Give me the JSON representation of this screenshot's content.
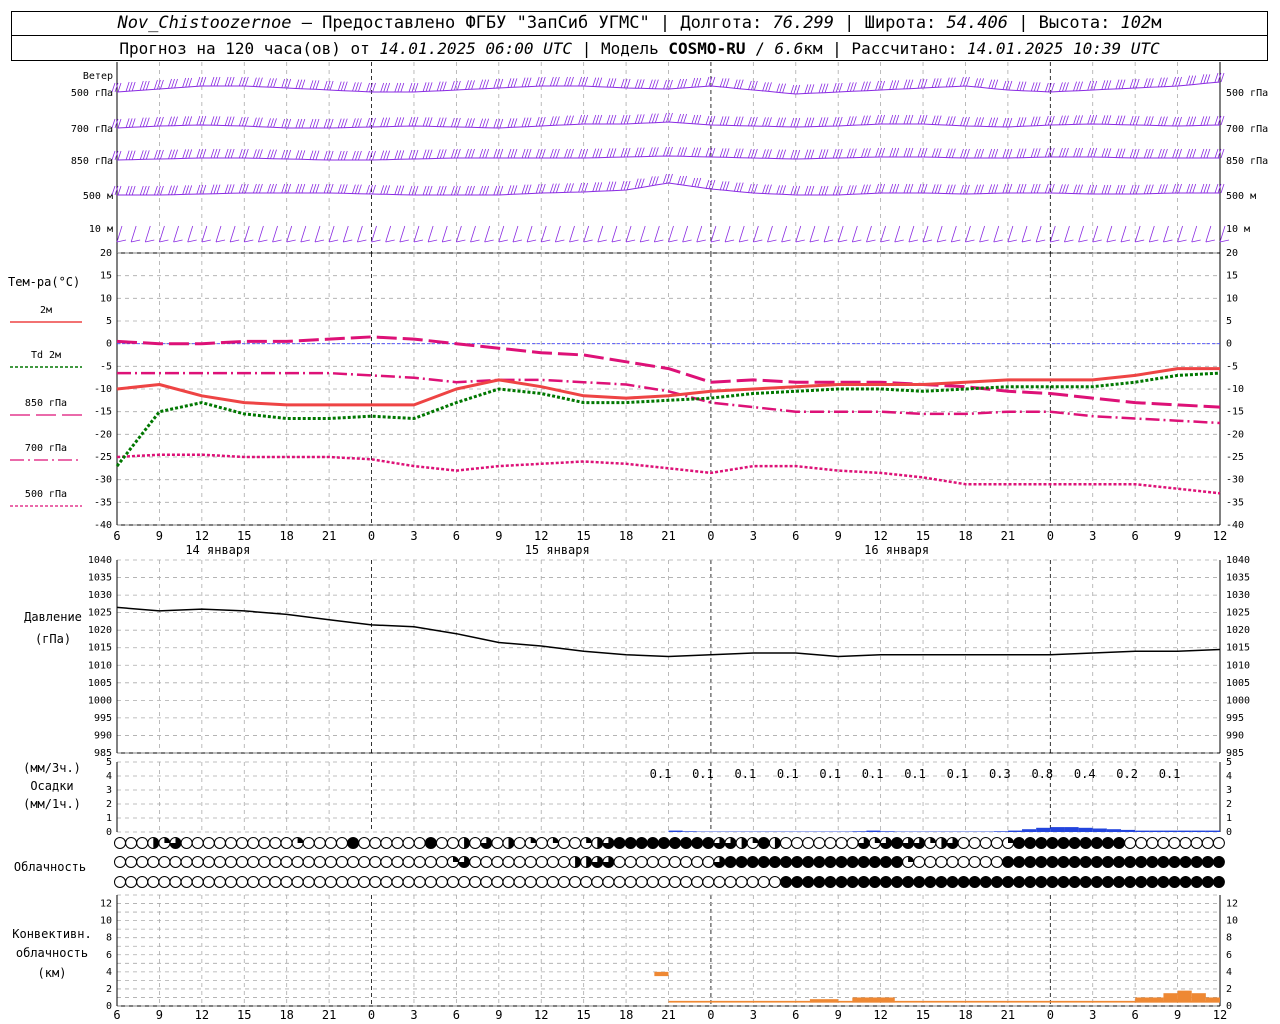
{
  "header": {
    "station": "Nov_Chistoozernoe",
    "provider": " — Предоставлено ФГБУ \"ЗапСиб УГМС\" | Долгота: ",
    "lon": "76.299",
    "lat_label": " | Широта: ",
    "lat": "54.406",
    "alt_label": " | Высота: ",
    "alt": "102",
    "alt_unit": "м",
    "forecast_pre": "Прогноз на 120 часа(ов) от ",
    "forecast_from": "14.01.2025 06:00 UTC",
    "model_label": "  | Модель ",
    "model": "COSMO-RU",
    "sep": " / ",
    "res": "6.6",
    "res_unit": "км | Рассчитано: ",
    "calc": "14.01.2025 10:39 UTC"
  },
  "labels": {
    "wind_title": "Ветер",
    "wind_levels": [
      "500 гПа",
      "700 гПа",
      "850 гПа",
      "500 м",
      "10  м"
    ],
    "temp_title": "Тем-ра(°С)",
    "legend": [
      "2м",
      "Td  2м",
      "850 гПа",
      "700 гПа",
      "500 гПа"
    ],
    "pressure_title": "Давление",
    "pressure_unit": "(гПа)",
    "precip": [
      "(мм/3ч.)",
      "Осадки",
      "(мм/1ч.)"
    ],
    "cloud_title": "Облачность",
    "conv": [
      "Конвективн.",
      "облачность",
      "(км)"
    ]
  },
  "colors": {
    "wind": "#8a2be2",
    "t2m": "#ee4444",
    "td2m": "#007700",
    "t850": "#dd1177",
    "t700": "#dd1177",
    "t500": "#dd1177",
    "pressure": "#000000",
    "precip": "#2244dd",
    "conv": "#ee8833",
    "zero": "#4444ff"
  },
  "chart_data": [
    {
      "type": "line",
      "title": "Тем-ра(°С)",
      "ylim": [
        -40,
        20
      ],
      "y_ticks": [
        20,
        15,
        10,
        5,
        0,
        -5,
        -10,
        -15,
        -20,
        -25,
        -30,
        -35,
        -40
      ],
      "x_ticks": [
        "6",
        "9",
        "12",
        "15",
        "18",
        "21",
        "0",
        "3",
        "6",
        "9",
        "12",
        "15",
        "18",
        "21",
        "0",
        "3",
        "6",
        "9",
        "12",
        "15",
        "18",
        "21",
        "0",
        "3",
        "6",
        "9",
        "12"
      ],
      "day_labels": [
        "14 января",
        "15 января",
        "16 января"
      ],
      "x": [
        6,
        9,
        12,
        15,
        18,
        21,
        24,
        27,
        30,
        33,
        36,
        39,
        42,
        45,
        48,
        51,
        54,
        57,
        60,
        63,
        66,
        69,
        72,
        75,
        78,
        81,
        84
      ],
      "series": [
        {
          "name": "2м",
          "values": [
            -10,
            -9,
            -11.5,
            -13,
            -13.5,
            -13.5,
            -13.5,
            -13.5,
            -10,
            -8,
            -9.5,
            -11.5,
            -12,
            -11.5,
            -10.5,
            -10,
            -9.5,
            -9,
            -9,
            -9,
            -8.5,
            -8,
            -8,
            -8,
            -7,
            -5.5,
            -5.5
          ]
        },
        {
          "name": "Td  2м",
          "values": [
            -27,
            -15,
            -13,
            -15.5,
            -16.5,
            -16.5,
            -16,
            -16.5,
            -13,
            -10,
            -11,
            -13,
            -13,
            -12.5,
            -12,
            -11,
            -10.5,
            -10,
            -10,
            -10.5,
            -10,
            -9.5,
            -9.5,
            -9.5,
            -8.5,
            -7,
            -6.5
          ]
        },
        {
          "name": "850 гПа",
          "values": [
            0.5,
            0,
            0,
            0.5,
            0.5,
            1,
            1.5,
            1,
            0,
            -1,
            -2,
            -2.5,
            -4,
            -5.5,
            -8.5,
            -8,
            -8.5,
            -8.5,
            -8.5,
            -9,
            -9.5,
            -10.5,
            -11,
            -12,
            -13,
            -13.5,
            -14
          ]
        },
        {
          "name": "700 гПа",
          "values": [
            -6.5,
            -6.5,
            -6.5,
            -6.5,
            -6.5,
            -6.5,
            -7,
            -7.5,
            -8.5,
            -8,
            -8,
            -8.5,
            -9,
            -10.5,
            -13,
            -14,
            -15,
            -15,
            -15,
            -15.5,
            -15.5,
            -15,
            -15,
            -16,
            -16.5,
            -17,
            -17.5
          ]
        },
        {
          "name": "500 гПа",
          "values": [
            -25,
            -24.5,
            -24.5,
            -25,
            -25,
            -25,
            -25.5,
            -27,
            -28,
            -27,
            -26.5,
            -26,
            -26.5,
            -27.5,
            -28.5,
            -27,
            -27,
            -28,
            -28.5,
            -29.5,
            -31,
            -31,
            -31,
            -31,
            -31,
            -32,
            -33
          ]
        }
      ]
    },
    {
      "type": "line",
      "title": "Давление",
      "ylabel": "(гПа)",
      "ylim": [
        985,
        1040
      ],
      "y_ticks": [
        1040,
        1035,
        1030,
        1025,
        1020,
        1015,
        1010,
        1005,
        1000,
        995,
        990,
        985
      ],
      "x": [
        6,
        9,
        12,
        15,
        18,
        21,
        24,
        27,
        30,
        33,
        36,
        39,
        42,
        45,
        48,
        51,
        54,
        57,
        60,
        63,
        66,
        69,
        72,
        75,
        78,
        81,
        84
      ],
      "series": [
        {
          "name": "Давление",
          "values": [
            1026.5,
            1025.5,
            1026,
            1025.5,
            1024.5,
            1023,
            1021.5,
            1021,
            1019,
            1016.5,
            1015.5,
            1014,
            1013,
            1012.5,
            1013,
            1013.5,
            1013.5,
            1012.5,
            1013,
            1013,
            1013,
            1013,
            1013,
            1013.5,
            1014,
            1014,
            1014.5
          ]
        }
      ]
    },
    {
      "type": "bar",
      "title": "Осадки",
      "ylim": [
        0,
        5
      ],
      "y_ticks": [
        5,
        4,
        3,
        2,
        1,
        0
      ],
      "labels_x": [
        45,
        48,
        51,
        54,
        57,
        60,
        63,
        66,
        69,
        72,
        75,
        78,
        81
      ],
      "labels": [
        "0.1",
        "0.1",
        "0.1",
        "0.1",
        "0.1",
        "0.1",
        "0.1",
        "0.1",
        "0.3",
        "0.8",
        "0.4",
        "0.2",
        "0.1"
      ],
      "x": [
        45,
        46,
        47,
        48,
        49,
        50,
        51,
        52,
        53,
        54,
        55,
        56,
        57,
        58,
        59,
        60,
        61,
        62,
        63,
        64,
        65,
        66,
        67,
        68,
        69,
        70,
        71,
        72,
        73,
        74,
        75,
        76,
        77,
        78,
        79,
        80,
        81,
        82,
        83
      ],
      "values": [
        0.1,
        0.05,
        0.03,
        0.03,
        0.03,
        0.03,
        0.03,
        0.03,
        0.03,
        0.03,
        0.03,
        0.03,
        0.03,
        0.05,
        0.1,
        0.05,
        0.03,
        0.03,
        0.03,
        0.03,
        0.03,
        0.03,
        0.03,
        0.05,
        0.1,
        0.2,
        0.3,
        0.35,
        0.35,
        0.3,
        0.25,
        0.2,
        0.15,
        0.1,
        0.1,
        0.1,
        0.1,
        0.1,
        0.1
      ]
    },
    {
      "type": "table",
      "title": "Облачность",
      "x_start": 6,
      "x_step": 1,
      "rows": [
        {
          "name": "upper",
          "values": [
            0,
            0,
            0,
            2,
            1,
            3,
            0,
            0,
            0,
            0,
            0,
            0,
            0,
            0,
            0,
            0,
            1,
            0,
            0,
            0,
            0,
            4,
            0,
            0,
            0,
            0,
            0,
            0,
            4,
            0,
            0,
            2,
            0,
            3,
            0,
            2,
            0,
            1,
            0,
            1,
            0,
            0,
            1,
            2,
            3,
            4,
            4,
            4,
            4,
            4,
            4,
            4,
            4,
            4,
            3,
            3,
            2,
            1,
            4,
            2,
            0,
            0,
            0,
            0,
            0,
            0,
            0,
            3,
            1,
            3,
            4,
            3,
            3,
            1,
            2,
            3,
            0,
            0,
            0,
            0,
            1,
            4,
            4,
            4,
            4,
            4,
            4,
            4,
            4,
            4,
            4,
            0,
            0,
            0,
            0,
            0,
            0,
            0,
            0,
            0
          ]
        },
        {
          "name": "middle",
          "values": [
            0,
            0,
            0,
            0,
            0,
            0,
            0,
            0,
            0,
            0,
            0,
            0,
            0,
            0,
            0,
            0,
            0,
            0,
            0,
            0,
            0,
            0,
            0,
            0,
            0,
            0,
            0,
            0,
            0,
            0,
            1,
            3,
            0,
            0,
            0,
            0,
            0,
            0,
            0,
            0,
            0,
            2,
            2,
            3,
            3,
            0,
            0,
            0,
            0,
            0,
            0,
            0,
            0,
            0,
            3,
            4,
            4,
            4,
            4,
            4,
            4,
            4,
            4,
            4,
            4,
            4,
            4,
            4,
            4,
            4,
            4,
            1,
            0,
            0,
            0,
            0,
            0,
            0,
            0,
            0,
            4,
            4,
            4,
            4,
            4,
            4,
            4,
            4,
            4,
            4,
            4,
            4,
            4,
            4,
            4,
            4,
            4,
            4,
            4,
            4
          ]
        },
        {
          "name": "lower",
          "values": [
            0,
            0,
            0,
            0,
            0,
            0,
            0,
            0,
            0,
            0,
            0,
            0,
            0,
            0,
            0,
            0,
            0,
            0,
            0,
            0,
            0,
            0,
            0,
            0,
            0,
            0,
            0,
            0,
            0,
            0,
            0,
            0,
            0,
            0,
            0,
            0,
            0,
            0,
            0,
            0,
            0,
            0,
            0,
            0,
            0,
            0,
            0,
            0,
            0,
            0,
            0,
            0,
            0,
            0,
            0,
            0,
            0,
            0,
            0,
            0,
            4,
            4,
            4,
            4,
            4,
            4,
            4,
            4,
            4,
            4,
            4,
            4,
            4,
            4,
            4,
            4,
            4,
            4,
            4,
            4,
            4,
            4,
            4,
            4,
            4,
            4,
            4,
            4,
            4,
            4,
            4,
            4,
            4,
            4,
            4,
            4,
            4,
            4,
            4,
            4
          ]
        }
      ]
    },
    {
      "type": "bar",
      "title": "Конвективн. облачность (км)",
      "ylim": [
        0,
        13
      ],
      "y_ticks": [
        12,
        10,
        8,
        6,
        4,
        2,
        0
      ],
      "segments": [
        {
          "x0": 44,
          "x1": 45,
          "bottom": 3.5,
          "top": 4.0
        },
        {
          "x0": 45,
          "x1": 84,
          "bottom": 0.4,
          "top": 0.6
        },
        {
          "x0": 55,
          "x1": 57,
          "bottom": 0.4,
          "top": 0.8
        },
        {
          "x0": 58,
          "x1": 61,
          "bottom": 0.4,
          "top": 1.0
        },
        {
          "x0": 78,
          "x1": 80,
          "bottom": 0.4,
          "top": 1.0
        },
        {
          "x0": 80,
          "x1": 81,
          "bottom": 0.4,
          "top": 1.5
        },
        {
          "x0": 81,
          "x1": 82,
          "bottom": 0.4,
          "top": 1.8
        },
        {
          "x0": 82,
          "x1": 83,
          "bottom": 0.4,
          "top": 1.5
        },
        {
          "x0": 83,
          "x1": 84,
          "bottom": 0.4,
          "top": 1.0
        }
      ]
    }
  ]
}
